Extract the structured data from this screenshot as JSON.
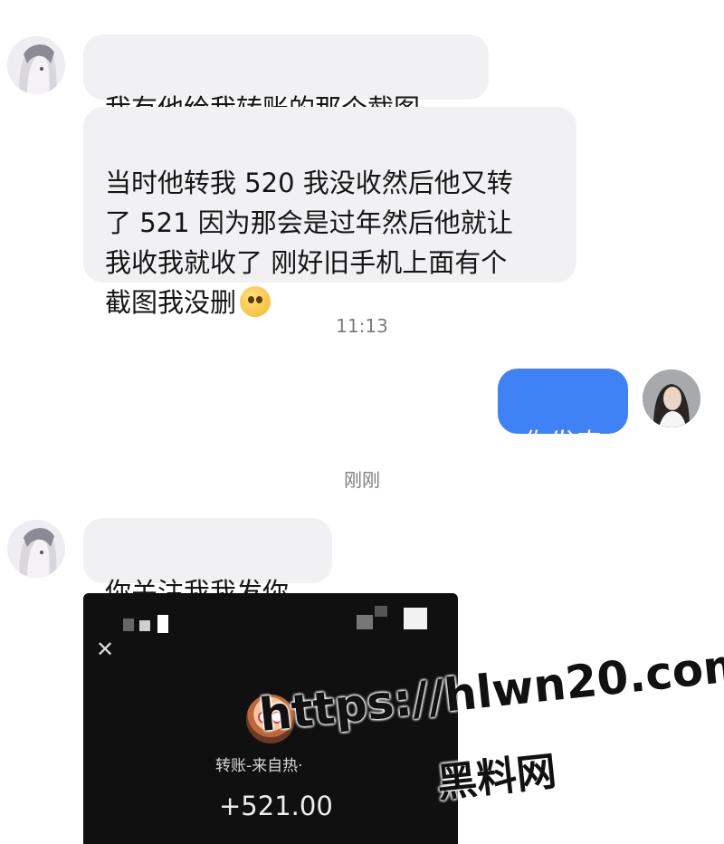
{
  "chat": {
    "messages": [
      {
        "sender": "other",
        "text": "我有他给我转账的那个截图"
      },
      {
        "sender": "other",
        "text": "当时他转我 520 我没收然后他又转\n了 521  因为那会是过年然后他就让\n我收我就收了 刚好旧手机上面有个\n截图我没删"
      },
      {
        "sender": "me",
        "text": "你发来"
      },
      {
        "sender": "other",
        "text": "你关注我我发你"
      }
    ],
    "timestamps": [
      "11:13",
      "刚刚"
    ],
    "emoji_after_message_2": "pleading-face-emoji"
  },
  "screenshot": {
    "close_glyph": "✕",
    "source_label": "转账-来自热·",
    "amount": "+521.00"
  },
  "watermark": {
    "url": "https://hlwn20.com",
    "site": "黑料网"
  },
  "colors": {
    "my_bubble": "#3f82f5",
    "other_bubble": "#f1f1f3",
    "screenshot_bg": "#101010"
  }
}
